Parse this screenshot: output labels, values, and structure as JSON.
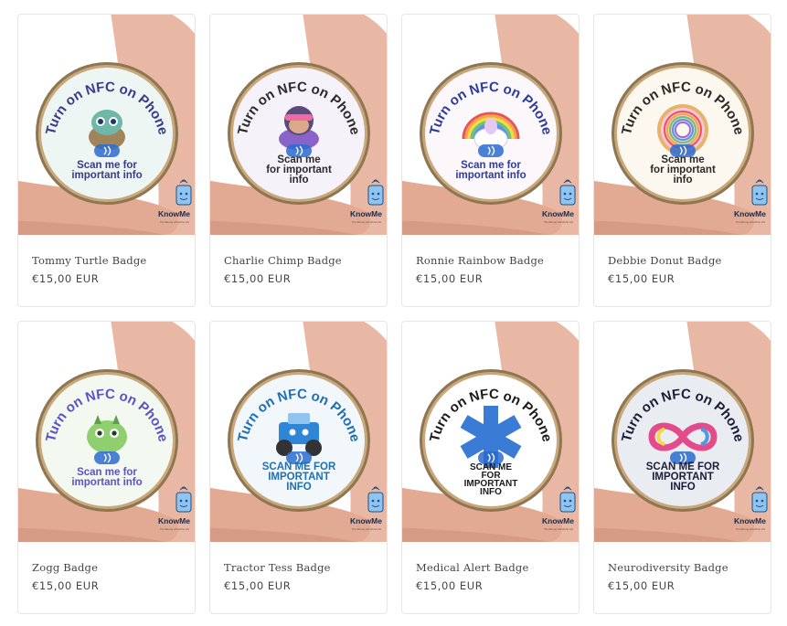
{
  "products": [
    {
      "title": "Tommy Turtle Badge",
      "price": "€15,00",
      "currency": "EUR",
      "badge_text_top": "Turn on NFC on Phone",
      "badge_text_bottom": [
        "Scan me for",
        "important info"
      ],
      "badge_bg": "#eef6f4",
      "accent": "#3a3a8a",
      "mascot_color": "#6fb7a8",
      "mascot": "turtle-icon"
    },
    {
      "title": "Charlie Chimp Badge",
      "price": "€15,00",
      "currency": "EUR",
      "badge_text_top": "Turn on NFC on Phone",
      "badge_text_bottom": [
        "Scan me",
        "for important",
        "info"
      ],
      "badge_bg": "#f5f2fa",
      "accent": "#2b2b2b",
      "mascot_color": "#8a63c9",
      "mascot": "chimp-icon"
    },
    {
      "title": "Ronnie Rainbow Badge",
      "price": "€15,00",
      "currency": "EUR",
      "badge_text_top": "Turn on NFC on Phone",
      "badge_text_bottom": [
        "Scan me for",
        "important info"
      ],
      "badge_bg": "#fbf7fb",
      "accent": "#2d3b9e",
      "mascot_color": "#f06aa0",
      "mascot": "rainbow-icon"
    },
    {
      "title": "Debbie Donut Badge",
      "price": "€15,00",
      "currency": "EUR",
      "badge_text_top": "Turn on NFC on Phone",
      "badge_text_bottom": [
        "Scan me",
        "for important",
        "info"
      ],
      "badge_bg": "#fdf8ef",
      "accent": "#2a2a2a",
      "mascot_color": "#f2a649",
      "mascot": "donut-icon"
    },
    {
      "title": "Zogg Badge",
      "price": "€15,00",
      "currency": "EUR",
      "badge_text_top": "Turn on NFC on Phone",
      "badge_text_bottom": [
        "Scan me for",
        "important info"
      ],
      "badge_bg": "#f3f9f1",
      "accent": "#5a52c8",
      "mascot_color": "#8fcf6e",
      "mascot": "dragon-icon"
    },
    {
      "title": "Tractor Tess Badge",
      "price": "€15,00",
      "currency": "EUR",
      "badge_text_top": "Turn on NFC on Phone",
      "badge_text_bottom": [
        "SCAN ME FOR",
        "IMPORTANT",
        "INFO"
      ],
      "badge_bg": "#f2f7fb",
      "accent": "#1f6fb2",
      "mascot_color": "#2f86d6",
      "mascot": "tractor-icon"
    },
    {
      "title": "Medical Alert Badge",
      "price": "€15,00",
      "currency": "EUR",
      "badge_text_top": "Turn on NFC on Phone",
      "badge_text_bottom": [
        "SCAN ME",
        "FOR",
        "IMPORTANT",
        "INFO"
      ],
      "badge_bg": "#ffffff",
      "accent": "#1b1b1b",
      "mascot_color": "#3a7bd5",
      "mascot": "star-of-life-icon"
    },
    {
      "title": "Neurodiversity Badge",
      "price": "€15,00",
      "currency": "EUR",
      "badge_text_top": "Turn on NFC on Phone",
      "badge_text_bottom": [
        "SCAN ME FOR",
        "IMPORTANT",
        "INFO"
      ],
      "badge_bg": "#e9edf1",
      "accent": "#1d1d3a",
      "mascot_color": "#e34c8c",
      "mascot": "infinity-icon"
    }
  ],
  "brand": {
    "name": "KnowMe",
    "tagline": "The little tag with all the info"
  },
  "colors": {
    "skin": "#e9b8a4",
    "ring": "#c9a77c",
    "nfc_blue": "#2b6bd1"
  }
}
